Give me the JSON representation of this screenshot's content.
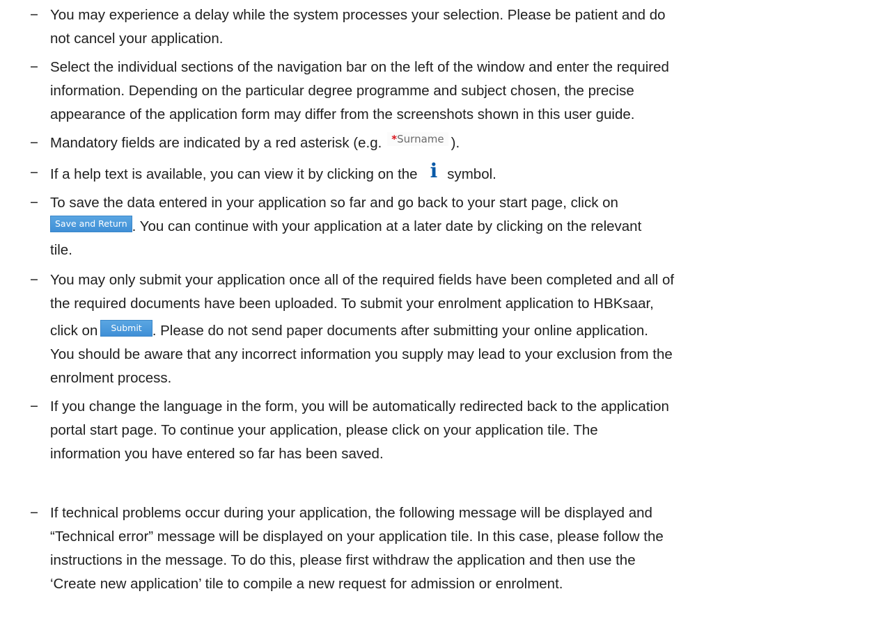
{
  "bullet_glyph": "−",
  "items": [
    {
      "lines": [
        "You may experience a delay while the system processes your selection. Please be patient and do",
        "not cancel your application."
      ]
    },
    {
      "lines": [
        "Select the individual sections of the navigation bar on the left of the window and enter the required",
        "information. Depending on the particular degree programme and subject chosen, the precise",
        "appearance of the application form may differ from the screenshots shown in this user guide."
      ]
    },
    {
      "before": "Mandatory fields are indicated by a red asterisk (e.g.",
      "sample_star": "*",
      "sample_label": "Surname",
      "after": ")."
    },
    {
      "before": "If a help text is available, you can view it by clicking on the",
      "icon_glyph": "i",
      "icon_name": "info-icon",
      "after": "symbol."
    },
    {
      "line1": "To save the data entered in your application so far and go back to your start page, click on",
      "button_label": "Save and Return",
      "after": ". You can continue with your application at a later date by clicking on the relevant",
      "line3": "tile."
    },
    {
      "line1": "You may only submit your application once all of the required fields have been completed and all of",
      "line2": "the required documents have been uploaded. To submit your enrolment application to HBKsaar,",
      "before_button": "click on",
      "button_label": "Submit",
      "after": ". Please do not send paper documents after submitting your online application.",
      "line4": "You should be aware that any incorrect information you supply may lead to your exclusion from the",
      "line5": "enrolment process."
    },
    {
      "lines": [
        "If you change the language in the form, you will be automatically redirected back to the application",
        "portal start page. To continue your application, please click on your application tile. The",
        "information you have entered so far has been saved."
      ]
    },
    {
      "lines": [
        "If technical problems occur during your application, the following message will be displayed and",
        "“Technical error” message will be displayed on your application tile. In this case, please follow the",
        "instructions in the message. To do this, please first withdraw the application and then use the",
        "‘Create new application’ tile to compile a new request for admission or enrolment."
      ]
    }
  ],
  "colors": {
    "text": "#1f1f1f",
    "asterisk": "#d9141c",
    "info_icon": "#0a5aa8",
    "button_bg": "#4a9ade"
  }
}
